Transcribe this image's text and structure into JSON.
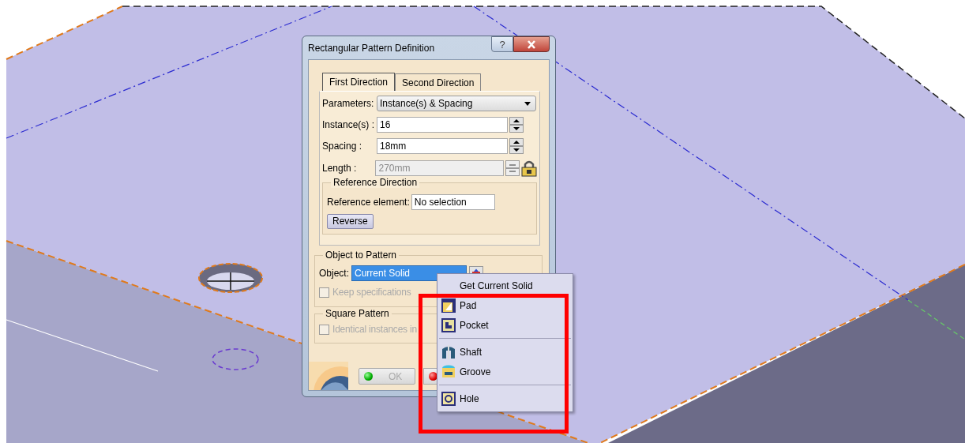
{
  "dialog": {
    "title": "Rectangular Pattern Definition",
    "help": "?",
    "tabs": [
      {
        "label": "First Direction",
        "selected": true
      },
      {
        "label": "Second Direction",
        "selected": false
      }
    ],
    "parameters": {
      "label": "Parameters:",
      "value": "Instance(s) & Spacing"
    },
    "fields": [
      {
        "label": "Instance(s) :",
        "value": "16",
        "disabled": false
      },
      {
        "label": "Spacing :",
        "value": "18mm",
        "disabled": false
      },
      {
        "label": "Length :",
        "value": "270mm",
        "disabled": true
      }
    ],
    "reference_direction": {
      "title": "Reference Direction",
      "label": "Reference element:",
      "value": "No selection",
      "button": "Reverse"
    },
    "object_to_pattern": {
      "title": "Object to Pattern",
      "label": "Object:",
      "value": "Current Solid",
      "keep": {
        "label": "Keep specifications",
        "checked": false,
        "disabled": true
      }
    },
    "square_pattern": {
      "title": "Square Pattern",
      "identical": {
        "label": "Identical instances in",
        "checked": false,
        "disabled": true
      }
    },
    "ok": {
      "label": "OK",
      "disabled": true
    }
  },
  "context_menu": {
    "groups": [
      {
        "items": [
          {
            "label": "Get Current Solid",
            "kind": "text"
          }
        ]
      },
      {
        "items": [
          {
            "label": "Pad",
            "kind": "pad"
          },
          {
            "label": "Pocket",
            "kind": "pocket"
          }
        ]
      },
      {
        "items": [
          {
            "label": "Shaft",
            "kind": "shaft"
          },
          {
            "label": "Groove",
            "kind": "groove"
          }
        ]
      },
      {
        "items": [
          {
            "label": "Hole",
            "kind": "hole"
          }
        ]
      }
    ]
  }
}
